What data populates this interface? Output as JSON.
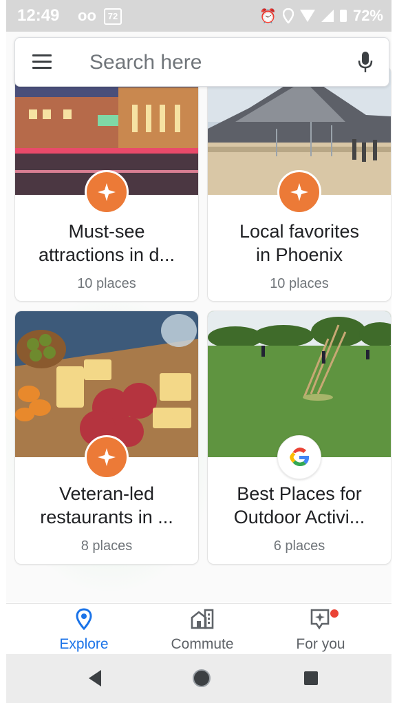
{
  "status_bar": {
    "time": "12:49",
    "voicemail_glyph": "oo",
    "calendar_day": "72",
    "battery": "72%",
    "icons": [
      "voicemail-icon",
      "calendar-icon",
      "alarm-icon",
      "location-icon",
      "wifi-icon",
      "cell-signal-icon",
      "battery-icon"
    ]
  },
  "search": {
    "placeholder": "Search here",
    "menu_icon": "hamburger-menu-icon",
    "mic_icon": "microphone-icon"
  },
  "cards": [
    {
      "title_line1": "Must-see",
      "title_line2": "attractions in d...",
      "count": "10 places",
      "badge": "star-badge-icon",
      "image": "night-building-photo"
    },
    {
      "title_line1": "Local favorites",
      "title_line2": "in Phoenix",
      "count": "10 places",
      "badge": "star-badge-icon",
      "image": "museum-plaza-photo"
    },
    {
      "title_line1": "Veteran-led",
      "title_line2": "restaurants in ...",
      "count": "8 places",
      "badge": "star-badge-icon",
      "image": "charcuterie-board-photo"
    },
    {
      "title_line1": "Best Places for",
      "title_line2": "Outdoor Activi...",
      "count": "6 places",
      "badge": "google-logo-icon",
      "image": "park-field-photo"
    }
  ],
  "bottom_nav": [
    {
      "label": "Explore",
      "icon": "location-pin-icon",
      "active": true
    },
    {
      "label": "Commute",
      "icon": "commute-building-icon",
      "active": false
    },
    {
      "label": "For you",
      "icon": "for-you-sparkle-icon",
      "active": false,
      "notification": true
    }
  ],
  "system_nav": [
    "back-icon",
    "home-icon",
    "recents-icon"
  ],
  "colors": {
    "accent": "#1a73e8",
    "badge_orange": "#ec7a37",
    "notification_red": "#ea4335",
    "status_bar": "#d7d7d7"
  }
}
